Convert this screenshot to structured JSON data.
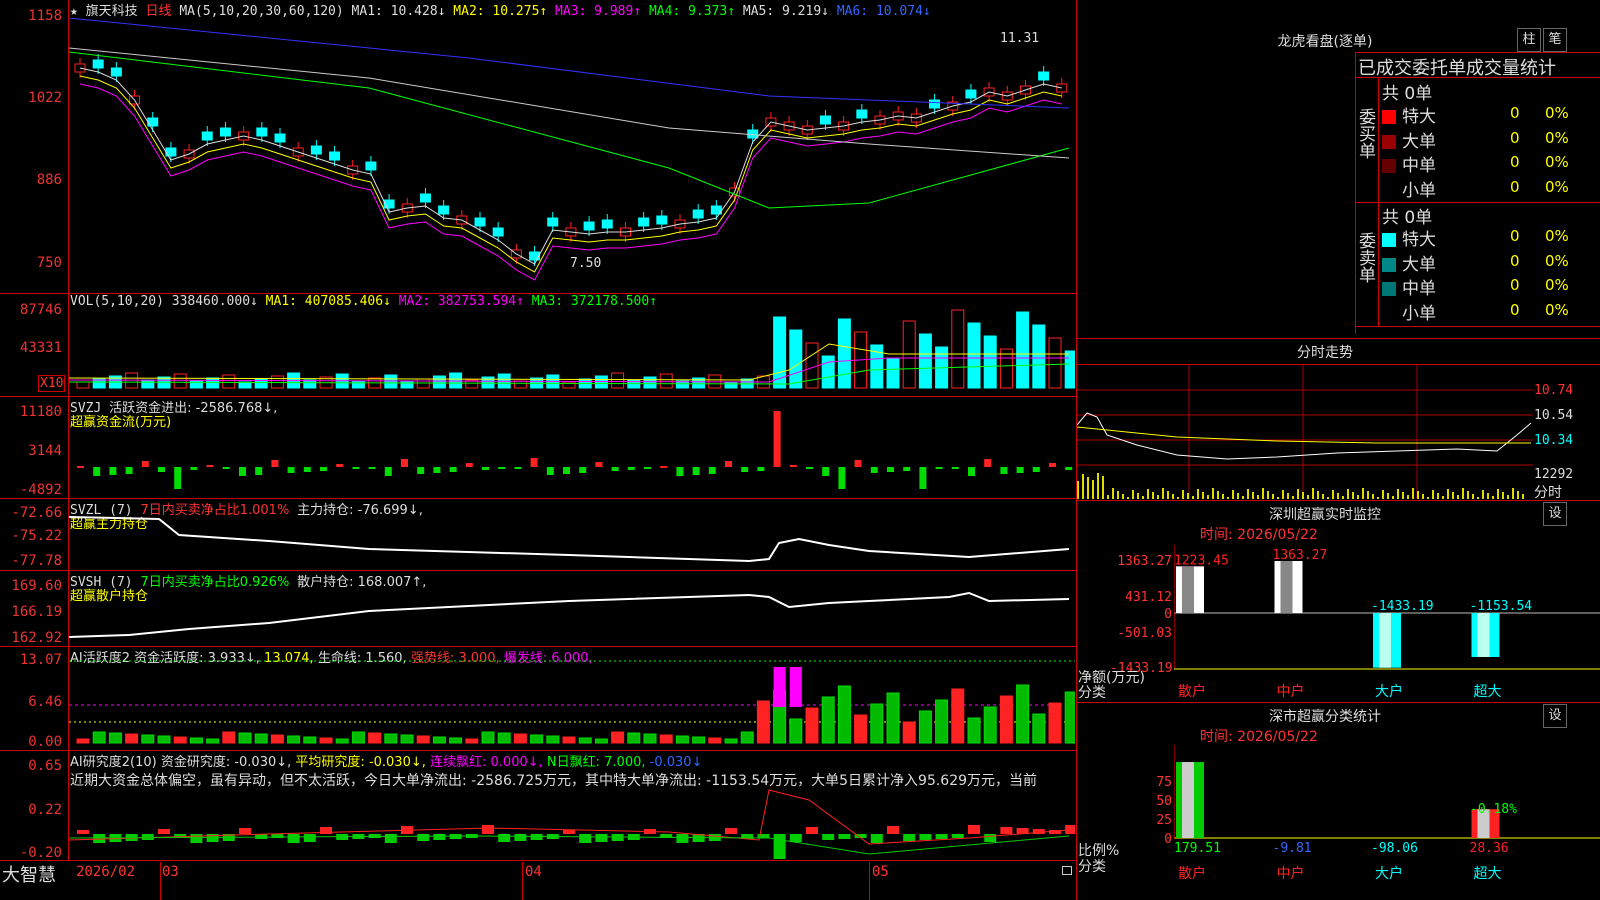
{
  "title_bar": {
    "star": "★",
    "stock_name": "旗天科技",
    "period": "日线",
    "ma_params": "MA(5,10,20,30,60,120)",
    "ma": [
      {
        "label": "MA1: 10.428↓",
        "color": "#ddd"
      },
      {
        "label": "MA2: 10.275↑",
        "color": "#ff0"
      },
      {
        "label": "MA3: 9.989↑",
        "color": "#f0f"
      },
      {
        "label": "MA4: 9.373↑",
        "color": "#0f0"
      },
      {
        "label": "MA5: 9.219↓",
        "color": "#ccc"
      },
      {
        "label": "MA6: 10.074↓",
        "color": "#36f"
      }
    ]
  },
  "price_axis": [
    "1158",
    "1022",
    "886",
    "750"
  ],
  "price_annotations": {
    "high": "11.31",
    "low": "7.50"
  },
  "vol_panel": {
    "label": "VOL(5,10,20)",
    "value": "338460.000↓",
    "ma1": "MA1: 407085.406↓",
    "ma2": "MA2: 382753.594↑",
    "ma3": "MA3: 372178.500↑",
    "axis": [
      "87746",
      "43331"
    ],
    "unit": "X10"
  },
  "svzj_panel": {
    "label": "SVZJ",
    "desc": "活跃资金进出: -2586.768↓,",
    "sub": "超赢资金流(万元)",
    "axis": [
      "11180",
      "3144",
      "-4892"
    ]
  },
  "svzl_panel": {
    "label": "SVZL (7)",
    "desc1": "7日内买卖净占比1.001%",
    "desc2": "主力持仓: -76.699↓,",
    "sub": "超赢主力持仓",
    "axis": [
      "-72.66",
      "-75.22",
      "-77.78"
    ]
  },
  "svsh_panel": {
    "label": "SVSH (7)",
    "desc1": "7日内买卖净占比0.926%",
    "desc2": "散户持仓: 168.007↑,",
    "sub": "超赢散户持仓",
    "axis": [
      "169.60",
      "166.19",
      "162.92"
    ]
  },
  "ai_active_panel": {
    "label": "AI活跃度2",
    "d1": "资金活跃度: 3.933↓,",
    "d2": "13.074,",
    "d3": "生命线: 1.560,",
    "d4": "强势线: 3.000,",
    "d5": "爆发线: 6.000,",
    "axis": [
      "13.07",
      "6.46",
      "0.00"
    ]
  },
  "ai_research_panel": {
    "label": "AI研究度2(10)",
    "d1": "资金研究度: -0.030↓,",
    "d2": "平均研究度: -0.030↓,",
    "d3": "连续飘红: 0.000↓,",
    "d4": "N日飘红: 7.000,",
    "d5": "-0.030↓",
    "text": "近期大资金总体偏空，虽有异动，但不太活跃，今日大单净流出: -2586.725万元，其中特大单净流出: -1153.54万元，大单5日累计净入95.629万元，当前",
    "axis": [
      "0.65",
      "0.22",
      "-0.20"
    ]
  },
  "bottom_bar": {
    "brand": "大智慧",
    "dates": [
      "2026/02",
      "03",
      "04",
      "05"
    ]
  },
  "right_panel": {
    "lhb_title": "龙虎看盘(逐单)",
    "btn_zhu": "柱",
    "btn_bi": "笔",
    "tabs": "已成交委托单成交量统计",
    "buy_side": {
      "label": "委买单",
      "total": "共 0单",
      "rows": [
        {
          "name": "特大",
          "value": "0",
          "pct": "0%",
          "color": "#f00"
        },
        {
          "name": "大单",
          "value": "0",
          "pct": "0%",
          "color": "#900"
        },
        {
          "name": "中单",
          "value": "0",
          "pct": "0%",
          "color": "#600"
        },
        {
          "name": "小单",
          "value": "0",
          "pct": "0%",
          "color": ""
        }
      ]
    },
    "sell_side": {
      "label": "委卖单",
      "total": "共 0单",
      "rows": [
        {
          "name": "特大",
          "value": "0",
          "pct": "0%",
          "color": "#0ff"
        },
        {
          "name": "大单",
          "value": "0",
          "pct": "0%",
          "color": "#088"
        },
        {
          "name": "中单",
          "value": "0",
          "pct": "0%",
          "color": "#077"
        },
        {
          "name": "小单",
          "value": "0",
          "pct": "0%",
          "color": ""
        }
      ]
    },
    "intraday": {
      "title": "分时走势",
      "axis": [
        "10.74",
        "10.54",
        "10.34",
        "12292"
      ],
      "label": "分时"
    },
    "sz_monitor": {
      "title": "深圳超赢实时监控",
      "btn": "设",
      "time": "时间: 2026/05/22",
      "axis": [
        "1363.27",
        "431.12",
        "0",
        "-501.03",
        "-1433.19"
      ],
      "ylabel": "净额(万元)",
      "xlabel": "分类",
      "categories": [
        "散户",
        "中户",
        "大户",
        "超大"
      ],
      "values": [
        "1223.45",
        "1363.27",
        "-1433.19",
        "-1153.54"
      ]
    },
    "sz_stats": {
      "title": "深市超赢分类统计",
      "btn": "设",
      "time": "时间: 2026/05/22",
      "axis": [
        "75",
        "50",
        "25",
        "0"
      ],
      "ylabel": "比例%",
      "xlabel": "分类",
      "categories": [
        "散户",
        "中户",
        "大户",
        "超大"
      ],
      "values": [
        "179.51",
        "-9.81",
        "-98.06",
        "28.36"
      ],
      "note": "-0.18%"
    }
  }
}
